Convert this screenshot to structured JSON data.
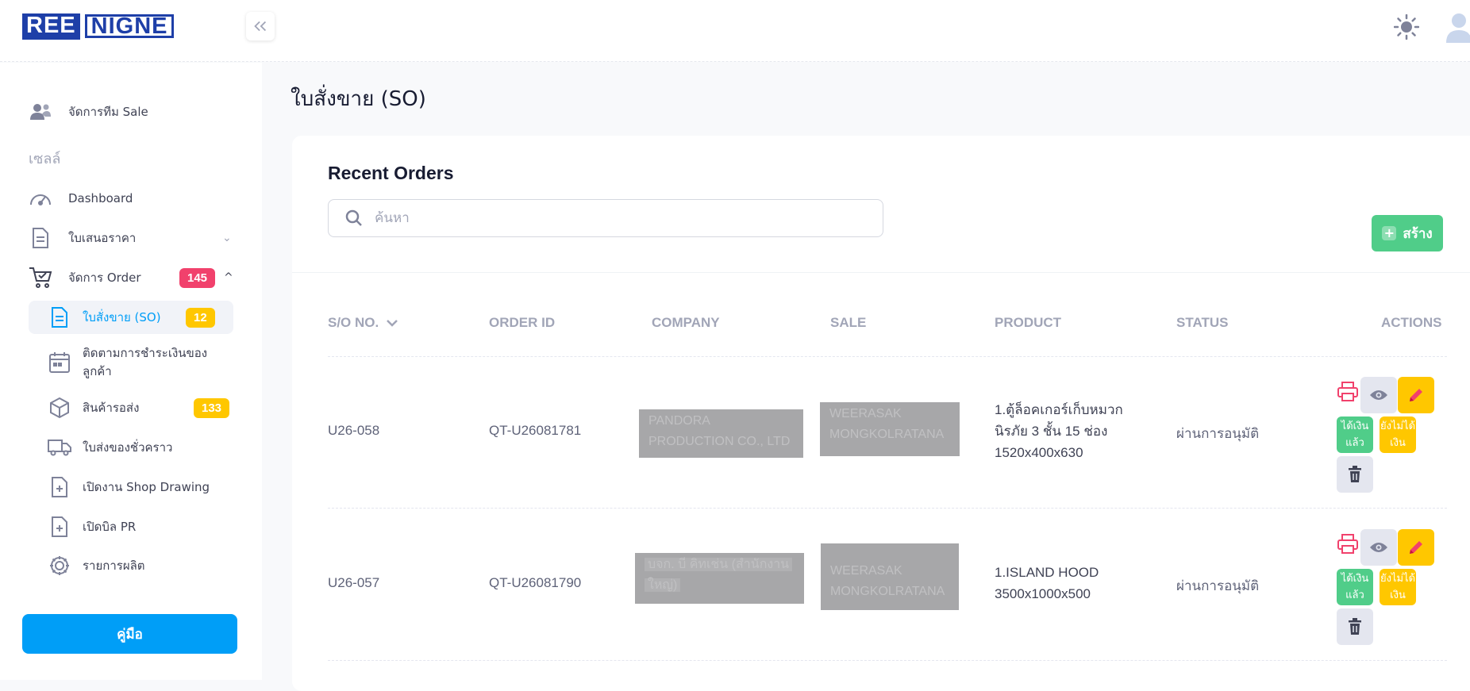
{
  "brand": {
    "logo_part1": "REE",
    "logo_part2": "NIGNE"
  },
  "colors": {
    "primary": "#009ef7",
    "success": "#50cd89",
    "warning": "#ffc700",
    "danger": "#f1416c",
    "brand": "#1e3fa8"
  },
  "sidebar": {
    "team_item": "จัดการทีม Sale",
    "section_sales": "เซลล์",
    "items": [
      {
        "label": "Dashboard",
        "icon": "speedometer-icon"
      },
      {
        "label": "ใบเสนอราคา",
        "icon": "document-icon"
      },
      {
        "label": "จัดการ Order",
        "icon": "cart-icon",
        "badge": "145"
      }
    ],
    "sub_items": [
      {
        "label": "ใบสั่งขาย (SO)",
        "badge": "12",
        "icon": "document-icon"
      },
      {
        "label_line1": "ติดตามการชำระเงินของ",
        "label_line2": "ลูกค้า",
        "icon": "calendar-icon"
      },
      {
        "label": "สินค้ารอส่ง",
        "badge": "133",
        "icon": "box-icon"
      },
      {
        "label": "ใบส่งของชั่วคราว",
        "icon": "truck-icon"
      },
      {
        "label": "เปิดงาน Shop Drawing",
        "icon": "file-plus-icon"
      },
      {
        "label": "เปิดบิล PR",
        "icon": "file-plus-icon"
      },
      {
        "label": "รายการผลิต",
        "icon": "gear-icon"
      }
    ],
    "manual_button": "คู่มือ"
  },
  "main": {
    "page_title": "ใบสั่งขาย (SO)",
    "card_title": "Recent Orders",
    "search_placeholder": "ค้นหา",
    "create_button": "สร้าง",
    "columns": [
      "S/O NO.",
      "ORDER ID",
      "COMPANY",
      "SALE",
      "PRODUCT",
      "STATUS",
      "ACTIONS"
    ],
    "rows": [
      {
        "so_no": "U26-058",
        "order_id": "QT-U26081781",
        "company_line1": "PANDORA",
        "company_line2": "PRODUCTION CO., LTD",
        "sale_line1": "WEERASAK",
        "sale_line2": "MONGKOLRATANA",
        "product_line1": "1.ตู้ล็อคเกอร์เก็บหมวก",
        "product_line2": "นิรภัย 3 ชั้น 15 ช่อง",
        "product_line3": "1520x400x630",
        "status": "ผ่านการอนุมัติ",
        "paid_line1": "ได้เงิน",
        "paid_line2": "แล้ว",
        "unpaid_line1": "ยังไม่ได้",
        "unpaid_line2": "เงิน"
      },
      {
        "so_no": "U26-057",
        "order_id": "QT-U26081790",
        "company_line1": "บจก. บี คิทเช่น (สำนักงาน",
        "company_line2": "ใหญ่)",
        "sale_line1": "WEERASAK",
        "sale_line2": "MONGKOLRATANA",
        "product_line1": "1.ISLAND HOOD",
        "product_line2": "3500x1000x500",
        "status": "ผ่านการอนุมัติ",
        "paid_line1": "ได้เงิน",
        "paid_line2": "แล้ว",
        "unpaid_line1": "ยังไม่ได้",
        "unpaid_line2": "เงิน"
      }
    ]
  }
}
